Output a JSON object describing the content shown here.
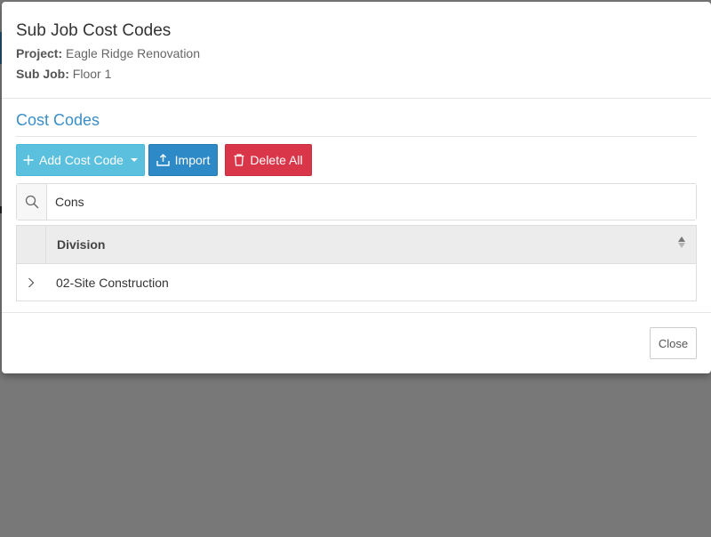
{
  "modal": {
    "title": "Sub Job Cost Codes",
    "project_label": "Project:",
    "project_value": "Eagle Ridge Renovation",
    "subjob_label": "Sub Job:",
    "subjob_value": "Floor 1"
  },
  "section": {
    "title": "Cost Codes"
  },
  "toolbar": {
    "add_label": "Add Cost Code",
    "import_label": "Import",
    "delete_all_label": "Delete All",
    "colors": {
      "add": "#5bc0de",
      "import": "#2d8ac7",
      "delete": "#d9364a"
    }
  },
  "search": {
    "value": "Cons",
    "icon": "search-icon"
  },
  "grid": {
    "columns": [
      "Division"
    ],
    "rows": [
      {
        "division": "02-Site Construction"
      }
    ]
  },
  "footer": {
    "close_label": "Close"
  }
}
